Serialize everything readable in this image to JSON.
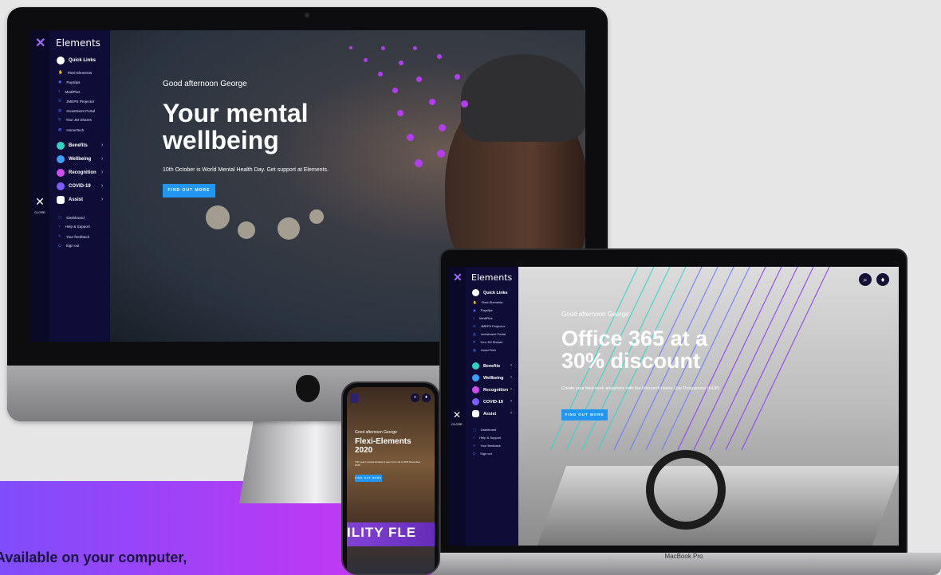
{
  "brand": "Elements",
  "close_label": "CLOSE",
  "quick_links": "Quick Links",
  "quick_items": [
    "Flexi-Elements",
    "Payslips",
    "MediPlus",
    "JMEPS Projector",
    "Investment Portal",
    "Your JM Shares",
    "HomeTech"
  ],
  "sections": [
    "Benefits",
    "Wellbeing",
    "Recognition",
    "COVID-19",
    "Assist"
  ],
  "bottom_items": [
    "Dashboard",
    "Help & Support",
    "Your feedback",
    "Sign out"
  ],
  "imac_hero": {
    "greeting": "Good afternoon George",
    "title_line1": "Your mental",
    "title_line2": "wellbeing",
    "subtitle": "10th October is World Mental Health Day. Get support at Elements.",
    "button": "FIND OUT MORE"
  },
  "macbook_hero": {
    "greeting": "Good afternoon George",
    "title_line1": "Office 365 at a",
    "title_line2": "30% discount",
    "subtitle": "Create your best work anywhere with the Microsoft Home Use Programme (HUP)",
    "button": "FIND OUT MORE"
  },
  "phone_hero": {
    "greeting": "Good afternoon George",
    "title_line1": "Flexi-Elements",
    "title_line2": "2020",
    "subtitle": "This year's annual window is open from 1st to 30th November 2020",
    "button": "FIND OUT MORE",
    "strip_text": "ILITY FLE"
  },
  "macbook_label": "MacBook Pro",
  "tagline": "Available on your computer,",
  "colors": {
    "sidebar": "#0f0d37",
    "accent_purple": "#b43cf0",
    "button_blue": "#2196f3",
    "icon_blue": "#4f6bff"
  }
}
